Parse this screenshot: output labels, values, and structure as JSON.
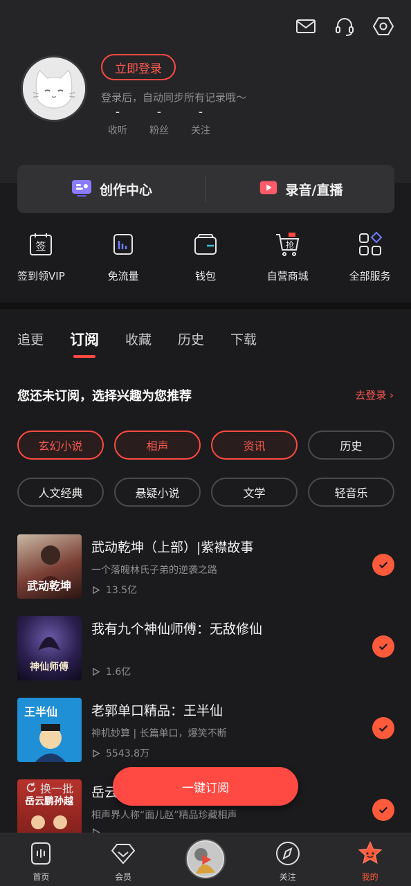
{
  "header": {
    "login_button": "立即登录",
    "login_hint": "登录后，自动同步所有记录哦～",
    "stats": [
      {
        "value": "-",
        "label": "收听"
      },
      {
        "value": "-",
        "label": "粉丝"
      },
      {
        "value": "-",
        "label": "关注"
      }
    ],
    "icons": [
      "mail-icon",
      "headset-icon",
      "settings-icon"
    ]
  },
  "create": {
    "studio_label": "创作中心",
    "record_label": "录音/直播"
  },
  "services": [
    {
      "label": "签到领VIP",
      "icon": "sign-in-icon",
      "glyph": "签"
    },
    {
      "label": "免流量",
      "icon": "data-free-icon"
    },
    {
      "label": "钱包",
      "icon": "wallet-icon"
    },
    {
      "label": "自营商城",
      "icon": "mall-cart-icon",
      "glyph": "抢"
    },
    {
      "label": "全部服务",
      "icon": "all-services-icon"
    }
  ],
  "tabs": [
    "追更",
    "订阅",
    "收藏",
    "历史",
    "下载"
  ],
  "active_tab": "订阅",
  "recommend": {
    "title": "您还未订阅，选择兴趣为您推荐",
    "login_link": "去登录"
  },
  "chips": [
    {
      "label": "玄幻小说",
      "selected": true
    },
    {
      "label": "相声",
      "selected": true
    },
    {
      "label": "资讯",
      "selected": true
    },
    {
      "label": "历史",
      "selected": false
    },
    {
      "label": "人文经典",
      "selected": false
    },
    {
      "label": "悬疑小说",
      "selected": false
    },
    {
      "label": "文学",
      "selected": false
    },
    {
      "label": "轻音乐",
      "selected": false
    }
  ],
  "items": [
    {
      "title": "武动乾坤（上部）|紫襟故事",
      "subtitle": "一个落魄林氏子弟的逆袭之路",
      "plays": "13.5亿",
      "cover_text": "武动乾坤"
    },
    {
      "title": "我有九个神仙师傅：无敌修仙",
      "subtitle": "",
      "plays": "1.6亿",
      "cover_text": "神仙师傅"
    },
    {
      "title": "老郭单口精品：王半仙",
      "subtitle": "神机妙算 | 长篇单口，爆笑不断",
      "plays": "5543.8万",
      "cover_text": "王半仙"
    },
    {
      "title": "岳云",
      "subtitle": "相声界人称“面儿赵”精品珍藏相声",
      "plays": "",
      "cover_text": "岳云鹏孙越"
    }
  ],
  "actions": {
    "subscribe_all": "一键订阅",
    "refresh": "换一批"
  },
  "bottom_nav": [
    {
      "label": "首页",
      "icon": "home-icon"
    },
    {
      "label": "会员",
      "icon": "vip-diamond-icon"
    },
    {
      "label": "",
      "icon": "now-playing-disc"
    },
    {
      "label": "关注",
      "icon": "follow-compass-icon"
    },
    {
      "label": "我的",
      "icon": "profile-star-icon",
      "active": true
    }
  ],
  "colors": {
    "accent": "#ff4a43",
    "check": "#ff5a3c",
    "background": "#1b1b1d"
  }
}
